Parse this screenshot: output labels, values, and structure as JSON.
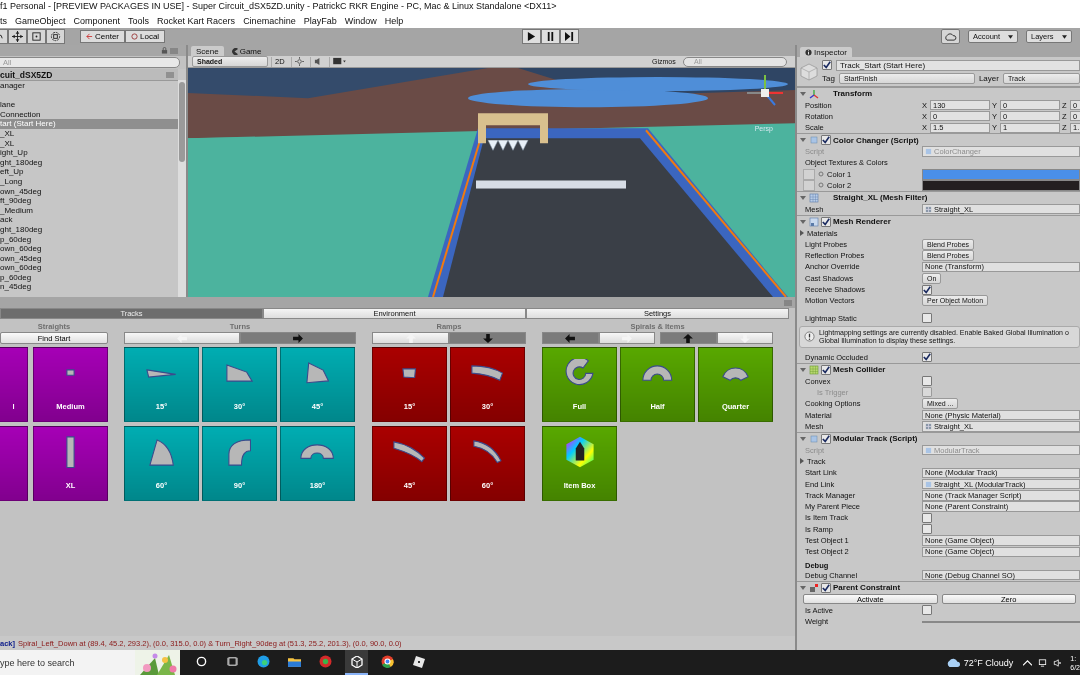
{
  "window": {
    "title": "f1 Personal - [PREVIEW PACKAGES IN USE] - Super Circuit_dSX5ZD.unity - PatrickC RKR Engine - PC, Mac & Linux Standalone <DX11>"
  },
  "menu": [
    "ts",
    "GameObject",
    "Component",
    "Tools",
    "Rocket Kart Racers",
    "Cinemachine",
    "PlayFab",
    "Window",
    "Help"
  ],
  "toolbar": {
    "pivot": [
      "Center",
      "Local"
    ],
    "account": "Account",
    "layers": "Layers"
  },
  "hierarchy": {
    "placeholder": "All",
    "scene": "cuit_dSX5ZD",
    "items": [
      {
        "kind": "object",
        "label": "anager",
        "selected": false
      },
      {
        "kind": "spacer"
      },
      {
        "kind": "object",
        "label": "lane",
        "selected": false
      },
      {
        "kind": "object",
        "label": "Connection",
        "selected": false
      },
      {
        "kind": "object",
        "label": "tart (Start Here)",
        "selected": true
      },
      {
        "kind": "object",
        "label": "_XL",
        "selected": false
      },
      {
        "kind": "object",
        "label": "_XL",
        "selected": false
      },
      {
        "kind": "object",
        "label": "ight_Up",
        "selected": false
      },
      {
        "kind": "object",
        "label": "ght_180deg",
        "selected": false
      },
      {
        "kind": "object",
        "label": "eft_Up",
        "selected": false
      },
      {
        "kind": "object",
        "label": "_Long",
        "selected": false
      },
      {
        "kind": "object",
        "label": "own_45deg",
        "selected": false
      },
      {
        "kind": "object",
        "label": "ft_90deg",
        "selected": false
      },
      {
        "kind": "object",
        "label": "_Medium",
        "selected": false
      },
      {
        "kind": "object",
        "label": "ack",
        "selected": false
      },
      {
        "kind": "object",
        "label": "ght_180deg",
        "selected": false
      },
      {
        "kind": "object",
        "label": "p_60deg",
        "selected": false
      },
      {
        "kind": "object",
        "label": "own_60deg",
        "selected": false
      },
      {
        "kind": "object",
        "label": "own_45deg",
        "selected": false
      },
      {
        "kind": "object",
        "label": "own_60deg",
        "selected": false
      },
      {
        "kind": "object",
        "label": "p_60deg",
        "selected": false
      },
      {
        "kind": "object",
        "label": "n_45deg",
        "selected": false
      }
    ]
  },
  "scene_view": {
    "tabs": [
      {
        "label": "Scene",
        "selected": true
      },
      {
        "label": "Game",
        "selected": false
      }
    ],
    "shading": "Shaded",
    "mode": "2D",
    "lighting_on": false,
    "audio_on": false,
    "gizmos": "Gizmos",
    "placeholder": "All",
    "overlay": "Persp"
  },
  "bottom_panel": {
    "tabs": [
      {
        "label": "Tracks",
        "selected": true
      },
      {
        "label": "Environment",
        "selected": false
      },
      {
        "label": "Settings",
        "selected": false
      }
    ],
    "sections": [
      {
        "title": "Straights",
        "color": "#a600b6",
        "controls": [
          {
            "kind": "button",
            "label": "Find Start"
          }
        ],
        "tiles": [
          {
            "kind": "cut",
            "label": "l"
          },
          {
            "kind": "full",
            "label": "Medium"
          },
          {
            "kind": "cut"
          },
          {
            "kind": "full",
            "label": "XL"
          }
        ]
      },
      {
        "title": "Turns",
        "color": "#00adb2",
        "controls": [
          {
            "kind": "toggle",
            "options": [
              {
                "selected": false
              },
              {
                "selected": true
              }
            ]
          }
        ],
        "tiles": [
          {
            "label": "15°"
          },
          {
            "label": "30°"
          },
          {
            "label": "45°"
          },
          {
            "label": "60°"
          },
          {
            "label": "90°"
          },
          {
            "label": "180°"
          }
        ]
      },
      {
        "title": "Ramps",
        "color": "#aa0000",
        "controls": [
          {
            "kind": "toggle",
            "options": [
              {
                "selected": false
              },
              {
                "selected": true
              }
            ]
          }
        ],
        "tiles": [
          {
            "label": "15°"
          },
          {
            "label": "30°"
          },
          {
            "label": "45°"
          },
          {
            "label": "60°"
          }
        ]
      },
      {
        "title": "Spirals & Items",
        "color": "#58a800",
        "controls": [
          {
            "kind": "toggle",
            "options": [
              {
                "selected": true
              },
              {
                "selected": false
              }
            ]
          },
          {
            "kind": "toggle",
            "options": [
              {
                "selected": true
              },
              {
                "selected": false
              }
            ]
          }
        ],
        "tiles": [
          {
            "label": "Full"
          },
          {
            "label": "Half"
          },
          {
            "label": "Quarter"
          },
          {
            "label": "Item Box"
          }
        ]
      }
    ]
  },
  "status_bar": {
    "source": "ack]",
    "message": "Spiral_Left_Down at (89.4, 45.2, 293.2), (0.0, 315.0, 0.0) & Turn_Right_90deg at (51.3, 25.2, 201.3), (0.0, 90.0, 0.0)"
  },
  "inspector": {
    "tab": "Inspector",
    "object": {
      "active": true,
      "name": "Track_Start (Start Here)",
      "tag_label": "Tag",
      "tag": "StartFinish",
      "layer_label": "Layer",
      "layer": "Track"
    },
    "components": [
      {
        "title": "Transform",
        "rows": [
          {
            "kind": "vector",
            "label": "Position",
            "values": [
              {
                "axis": "X",
                "value": "130"
              },
              {
                "axis": "Y",
                "value": "0"
              },
              {
                "axis": "Z",
                "value": "0"
              }
            ]
          },
          {
            "kind": "vector",
            "label": "Rotation",
            "values": [
              {
                "axis": "X",
                "value": "0"
              },
              {
                "axis": "Y",
                "value": "0"
              },
              {
                "axis": "Z",
                "value": "0"
              }
            ]
          },
          {
            "kind": "vector",
            "label": "Scale",
            "values": [
              {
                "axis": "X",
                "value": "1.5"
              },
              {
                "axis": "Y",
                "value": "1"
              },
              {
                "axis": "Z",
                "value": "1."
              }
            ]
          }
        ]
      },
      {
        "title": "Color Changer (Script)",
        "enabled": true,
        "rows": [
          {
            "kind": "script",
            "label": "Script",
            "value": "ColorChanger"
          },
          {
            "kind": "label",
            "label": "Object Textures & Colors"
          },
          {
            "kind": "color",
            "label": "Color 1",
            "color": "#4a8fe8"
          },
          {
            "kind": "color",
            "label": "Color 2",
            "color": "#231f20"
          }
        ]
      },
      {
        "title": "Straight_XL (Mesh Filter)",
        "rows": [
          {
            "kind": "asset",
            "label": "Mesh",
            "value": "Straight_XL"
          }
        ]
      },
      {
        "title": "Mesh Renderer",
        "enabled": true,
        "rows": [
          {
            "kind": "foldout",
            "label": "Materials",
            "expanded": false
          },
          {
            "kind": "dropdown",
            "label": "Light Probes",
            "value": "Blend Probes"
          },
          {
            "kind": "dropdown",
            "label": "Reflection Probes",
            "value": "Blend Probes"
          },
          {
            "kind": "field",
            "label": "Anchor Override",
            "value": "None (Transform)"
          },
          {
            "kind": "dropdown",
            "label": "Cast Shadows",
            "value": "On"
          },
          {
            "kind": "checkbox",
            "label": "Receive Shadows",
            "checked": true
          },
          {
            "kind": "dropdown",
            "label": "Motion Vectors",
            "value": "Per Object Motion"
          },
          {
            "kind": "spacer"
          },
          {
            "kind": "checkbox",
            "label": "Lightmap Static",
            "checked": false
          },
          {
            "kind": "info",
            "lines": [
              "Lightmapping settings are currently disabled. Enable Baked Global Illumination o",
              "Global Illumination to display these settings."
            ]
          },
          {
            "kind": "checkbox",
            "label": "Dynamic Occluded",
            "checked": true
          }
        ]
      },
      {
        "title": "Mesh Collider",
        "enabled": true,
        "rows": [
          {
            "kind": "checkbox",
            "label": "Convex",
            "checked": false,
            "children": [
              {
                "kind": "checkbox",
                "label": "Is Trigger",
                "checked": false,
                "disabled": true
              }
            ]
          },
          {
            "kind": "dropdown",
            "label": "Cooking Options",
            "value": "Mixed ..."
          },
          {
            "kind": "field",
            "label": "Material",
            "value": "None (Physic Material)"
          },
          {
            "kind": "asset",
            "label": "Mesh",
            "value": "Straight_XL"
          }
        ]
      },
      {
        "title": "Modular Track (Script)",
        "enabled": true,
        "rows": [
          {
            "kind": "script",
            "label": "Script",
            "value": "ModularTrack"
          },
          {
            "kind": "foldout",
            "label": "Track",
            "expanded": false
          },
          {
            "kind": "field",
            "label": "Start Link",
            "value": "None (Modular Track)"
          },
          {
            "kind": "scriptref",
            "label": "End Link",
            "value": "Straight_XL (ModularTrack)"
          },
          {
            "kind": "field",
            "label": "Track Manager",
            "value": "None (Track Manager Script)"
          },
          {
            "kind": "field",
            "label": "My Parent Piece",
            "value": "None (Parent Constraint)"
          },
          {
            "kind": "checkbox",
            "label": "Is Item Track",
            "checked": false
          },
          {
            "kind": "checkbox",
            "label": "Is Ramp",
            "checked": false
          },
          {
            "kind": "field",
            "label": "Test Object 1",
            "value": "None (Game Object)"
          },
          {
            "kind": "field",
            "label": "Test Object 2",
            "value": "None (Game Object)"
          },
          {
            "kind": "heading",
            "label": "Debug"
          },
          {
            "kind": "field",
            "label": "Debug Channel",
            "value": "None (Debug Channel SO)"
          }
        ]
      },
      {
        "title": "Parent Constraint",
        "enabled": true,
        "rows": [
          {
            "kind": "buttons",
            "labels": [
              "Activate",
              "Zero"
            ]
          },
          {
            "kind": "checkbox",
            "label": "Is Active",
            "checked": false
          },
          {
            "kind": "bar",
            "label": "Weight"
          }
        ]
      }
    ]
  },
  "taskbar": {
    "placeholder": "ype here to search",
    "weather": "72°F Cloudy",
    "time": "1:",
    "date": "6/2"
  }
}
